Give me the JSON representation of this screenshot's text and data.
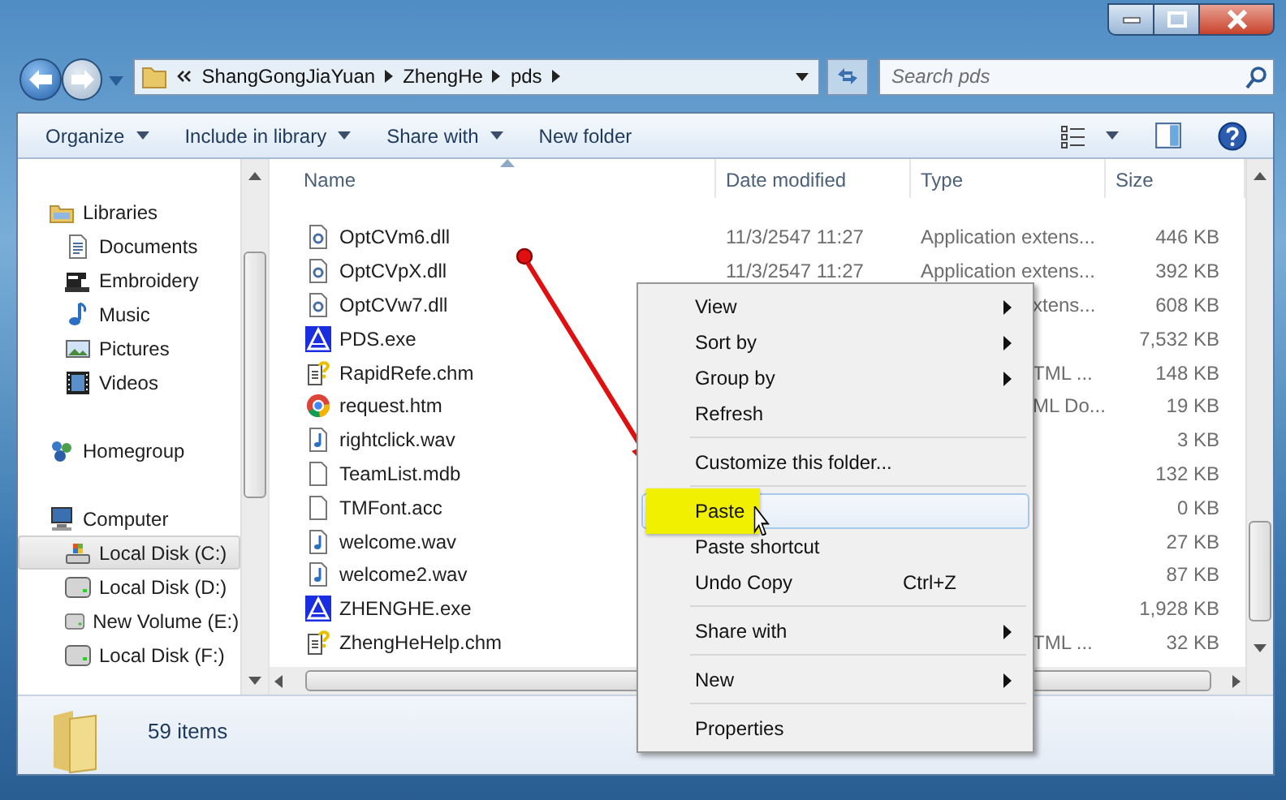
{
  "address": {
    "crumbs": [
      "ShangGongJiaYuan",
      "ZhengHe",
      "pds"
    ]
  },
  "search": {
    "placeholder": "Search pds"
  },
  "toolbar": [
    {
      "label": "Organize",
      "dropdown": true
    },
    {
      "label": "Include in library",
      "dropdown": true
    },
    {
      "label": "Share with",
      "dropdown": true
    },
    {
      "label": "New folder",
      "dropdown": false
    }
  ],
  "nav": [
    {
      "label": "Libraries",
      "kind": "libraries",
      "selected": false,
      "children": [
        {
          "label": "Documents",
          "kind": "documents",
          "selected": false
        },
        {
          "label": "Embroidery",
          "kind": "embroidery",
          "selected": false
        },
        {
          "label": "Music",
          "kind": "music",
          "selected": false
        },
        {
          "label": "Pictures",
          "kind": "pictures",
          "selected": false
        },
        {
          "label": "Videos",
          "kind": "videos",
          "selected": false
        }
      ]
    },
    {
      "label": "Homegroup",
      "kind": "homegroup",
      "selected": false
    },
    {
      "label": "Computer",
      "kind": "computer",
      "selected": false,
      "children": [
        {
          "label": "Local Disk (C:)",
          "kind": "system-disk",
          "selected": true
        },
        {
          "label": "Local Disk (D:)",
          "kind": "disk",
          "selected": false
        },
        {
          "label": "New Volume (E:)",
          "kind": "disk",
          "selected": false
        },
        {
          "label": "Local Disk (F:)",
          "kind": "disk",
          "selected": false
        }
      ]
    }
  ],
  "columns": [
    "Name",
    "Date modified",
    "Type",
    "Size"
  ],
  "rows": [
    {
      "name": "OptCVm6.dll",
      "kind": "dll",
      "date": "11/3/2547 11:27",
      "type": "Application extens...",
      "size": "446 KB"
    },
    {
      "name": "OptCVpX.dll",
      "kind": "dll",
      "date": "11/3/2547 11:27",
      "type": "Application extens...",
      "size": "392 KB"
    },
    {
      "name": "OptCVw7.dll",
      "kind": "dll",
      "type": "xtens...",
      "size": "608 KB"
    },
    {
      "name": "PDS.exe",
      "kind": "exe",
      "size": "7,532 KB"
    },
    {
      "name": "RapidRefe.chm",
      "kind": "chm",
      "type": "TML ...",
      "size": "148 KB"
    },
    {
      "name": "request.htm",
      "kind": "htm",
      "type": "ML Do...",
      "size": "19 KB"
    },
    {
      "name": "rightclick.wav",
      "kind": "wav",
      "size": "3 KB"
    },
    {
      "name": "TeamList.mdb",
      "kind": "file",
      "size": "132 KB"
    },
    {
      "name": "TMFont.acc",
      "kind": "file",
      "size": "0 KB"
    },
    {
      "name": "welcome.wav",
      "kind": "wav",
      "size": "27 KB"
    },
    {
      "name": "welcome2.wav",
      "kind": "wav",
      "size": "87 KB"
    },
    {
      "name": "ZHENGHE.exe",
      "kind": "exe",
      "size": "1,928 KB"
    },
    {
      "name": "ZhengHeHelp.chm",
      "kind": "chm",
      "type": "TML ...",
      "size": "32 KB"
    }
  ],
  "context_menu": [
    {
      "kind": "item",
      "label": "View",
      "submenu": true,
      "selected": false
    },
    {
      "kind": "item",
      "label": "Sort by",
      "submenu": true,
      "selected": false
    },
    {
      "kind": "item",
      "label": "Group by",
      "submenu": true,
      "selected": false
    },
    {
      "kind": "item",
      "label": "Refresh",
      "submenu": false,
      "selected": false
    },
    {
      "kind": "separator"
    },
    {
      "kind": "item",
      "label": "Customize this folder...",
      "submenu": false,
      "selected": false
    },
    {
      "kind": "separator"
    },
    {
      "kind": "item",
      "label": "Paste",
      "submenu": false,
      "selected": true
    },
    {
      "kind": "item",
      "label": "Paste shortcut",
      "submenu": false,
      "selected": false
    },
    {
      "kind": "item",
      "label": "Undo Copy",
      "shortcut": "Ctrl+Z",
      "submenu": false,
      "selected": false
    },
    {
      "kind": "separator"
    },
    {
      "kind": "item",
      "label": "Share with",
      "submenu": true,
      "selected": false
    },
    {
      "kind": "separator"
    },
    {
      "kind": "item",
      "label": "New",
      "submenu": true,
      "selected": false
    },
    {
      "kind": "separator"
    },
    {
      "kind": "item",
      "label": "Properties",
      "submenu": false,
      "selected": false
    }
  ],
  "status": {
    "count": "59 items"
  }
}
